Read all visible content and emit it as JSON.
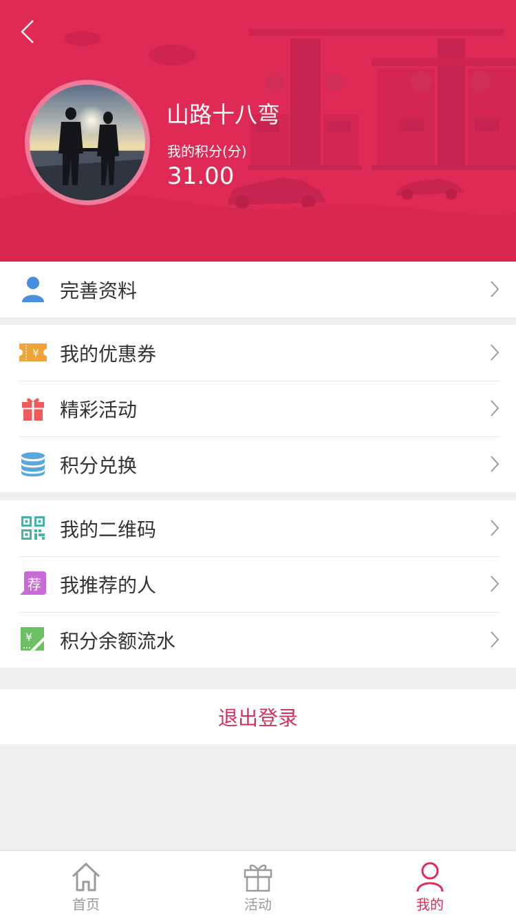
{
  "header": {
    "back_icon": "chevron-left-icon",
    "username": "山路十八弯",
    "points_label": "我的积分(分)",
    "points_value": "31.00",
    "background_color": "#e02a56"
  },
  "menu": {
    "group1": [
      {
        "label": "完善资料",
        "icon": "user-icon",
        "color": "#4a8ee0"
      }
    ],
    "group2": [
      {
        "label": "我的优惠券",
        "icon": "coupon-icon",
        "color": "#f0a338"
      },
      {
        "label": "精彩活动",
        "icon": "gift-icon",
        "color": "#ef5b5b"
      },
      {
        "label": "积分兑换",
        "icon": "coins-stack-icon",
        "color": "#5aa7de"
      }
    ],
    "group3": [
      {
        "label": "我的二维码",
        "icon": "qrcode-icon",
        "color": "#3fb3a8"
      },
      {
        "label": "我推荐的人",
        "icon": "recommend-icon",
        "color": "#c86ad8",
        "icon_text": "荐"
      },
      {
        "label": "积分余额流水",
        "icon": "ledger-icon",
        "color": "#6cbf63",
        "icon_text": "¥"
      }
    ]
  },
  "logout_label": "退出登录",
  "tabbar": {
    "items": [
      {
        "label": "首页",
        "icon": "home-icon",
        "active": false
      },
      {
        "label": "活动",
        "icon": "gift-icon",
        "active": false
      },
      {
        "label": "我的",
        "icon": "person-icon",
        "active": true
      }
    ],
    "active_color": "#e02a56"
  }
}
